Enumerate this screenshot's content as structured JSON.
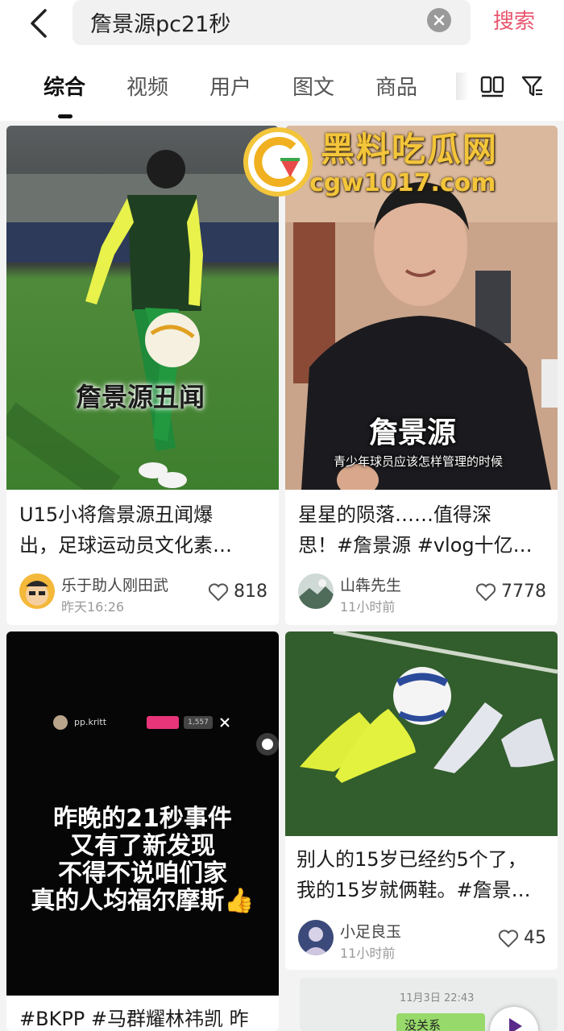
{
  "header": {
    "query": "詹景源pc21秒",
    "search_label": "搜索"
  },
  "tabs": [
    {
      "label": "综合",
      "active": true
    },
    {
      "label": "视频",
      "active": false
    },
    {
      "label": "用户",
      "active": false
    },
    {
      "label": "图文",
      "active": false
    },
    {
      "label": "商品",
      "active": false
    }
  ],
  "watermark": {
    "name": "黑料吃瓜网",
    "domain": "cgw1017.com"
  },
  "cards": [
    {
      "image_text": "詹景源丑闻",
      "title_lines": [
        "U15小将詹景源丑闻爆",
        "出，足球运动员文化素…"
      ],
      "author": "乐于助人刚田武",
      "time": "昨天16:26",
      "likes": "818"
    },
    {
      "image_text": "詹景源",
      "image_subtext": "青少年球员应该怎样管理的时候",
      "title_lines": [
        "星星的陨落……值得深",
        "思！#詹景源 #vlog十亿…"
      ],
      "author": "山犇先生",
      "time": "11小时前",
      "likes": "7778"
    },
    {
      "image_user": "pp.kritt",
      "image_count": "1,557",
      "image_lines": [
        "昨晚的21秒事件",
        "又有了新发现",
        "不得不说咱们家",
        "真的人均福尔摩斯👍"
      ],
      "title_lines": [
        "#BKPP #马群耀林祎凯 昨"
      ]
    },
    {
      "title_lines": [
        "别人的15岁已经约5个了，",
        "我的15岁就俩鞋。#詹景…"
      ],
      "author": "小足良玉",
      "time": "11小时前",
      "likes": "45"
    },
    {
      "chat_time": "11月3日 22:43",
      "chat_text": "没关系"
    }
  ],
  "colors": {
    "accent": "#e8566e",
    "watermark": "#f3c53a"
  }
}
